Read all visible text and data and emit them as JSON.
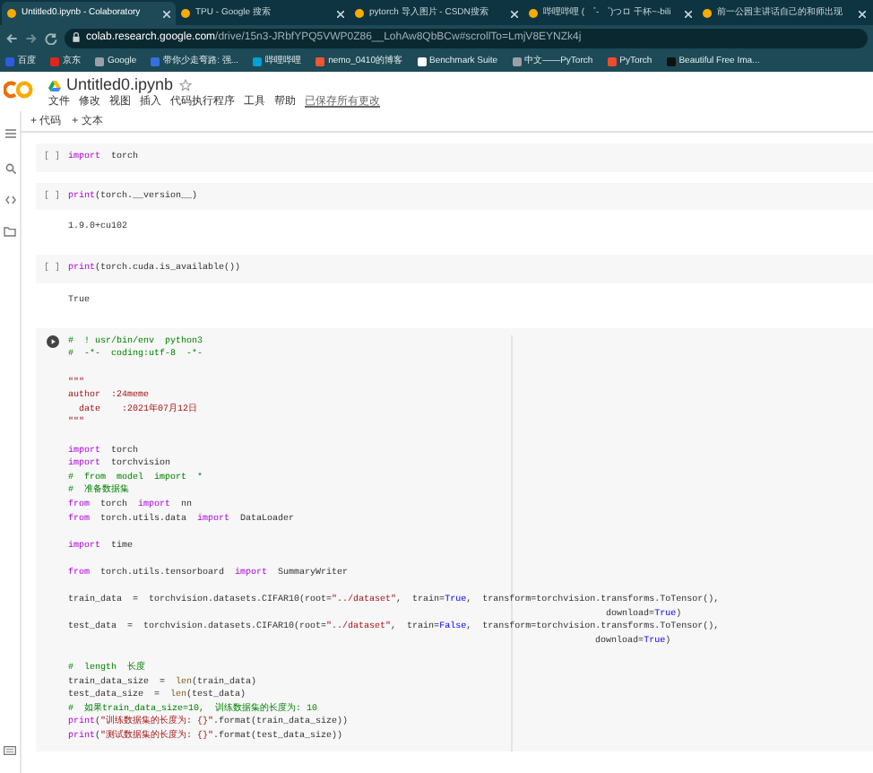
{
  "tabs": [
    {
      "title": "Untitled0.ipynb - Colaboratory",
      "selected": true
    },
    {
      "title": "TPU - Google 搜索",
      "selected": false
    },
    {
      "title": "pytorch 导入图片 - CSDN搜索",
      "selected": false
    },
    {
      "title": "哔哩哔哩 ( ゜- ゜)つロ 干杯~-bili",
      "selected": false
    },
    {
      "title": "前一公园主讲话自己的和师出现",
      "selected": false
    }
  ],
  "address": {
    "host": "colab.research.google.com",
    "path": "/drive/15n3-JRbfYPQ5VWP0Z86__LohAw8QbBCw#scrollTo=LmjV8EYNZk4j"
  },
  "bookmarks": [
    {
      "label": "百度",
      "color": "#2d5be3"
    },
    {
      "label": "京东",
      "color": "#e1251b"
    },
    {
      "label": "Google",
      "color": "#9aa0a6"
    },
    {
      "label": "带你少走弯路: 强...",
      "color": "#3670e0"
    },
    {
      "label": "哔哩哔哩",
      "color": "#00a1d6"
    },
    {
      "label": "nemo_0410的博客",
      "color": "#fc5531"
    },
    {
      "label": "Benchmark Suite",
      "color": "#ffffff"
    },
    {
      "label": "中文——PyTorch",
      "color": "#9aa0a6"
    },
    {
      "label": "PyTorch",
      "color": "#ee4c2c"
    },
    {
      "label": "Beautiful Free Ima...",
      "color": "#111111"
    }
  ],
  "notebook": {
    "title": "Untitled0.ipynb",
    "menu": [
      "文件",
      "修改",
      "视图",
      "插入",
      "代码执行程序",
      "工具",
      "帮助"
    ],
    "save_status": "已保存所有更改",
    "toolbar": [
      "+ 代码",
      "+ 文本"
    ]
  },
  "cells": [
    {
      "run_label": "[ ]",
      "lines": [
        {
          "segments": [
            {
              "kind": "keyword",
              "t": "import"
            },
            {
              "kind": "plain",
              "t": "  torch"
            }
          ]
        }
      ]
    },
    {
      "run_label": "[ ]",
      "lines": [
        {
          "segments": [
            {
              "kind": "keyword",
              "t": "print"
            },
            {
              "kind": "plain",
              "t": "(torch.__version__)"
            }
          ]
        }
      ],
      "output": "1.9.0+cu102"
    },
    {
      "run_label": "[ ]",
      "lines": [
        {
          "segments": [
            {
              "kind": "keyword",
              "t": "print"
            },
            {
              "kind": "plain",
              "t": "(torch.cuda.is_available())"
            }
          ]
        }
      ],
      "output": "True"
    },
    {
      "lines": [
        {
          "segments": [
            {
              "kind": "comment",
              "t": "#  ! usr/bin/env  python3"
            }
          ]
        },
        {
          "segments": [
            {
              "kind": "comment",
              "t": "#  -*-  coding:utf-8  -*-"
            }
          ]
        },
        {
          "space_before": true,
          "segments": [
            {
              "kind": "string",
              "t": "\"\"\""
            }
          ]
        },
        {
          "segments": [
            {
              "kind": "string",
              "t": "author  :24meme"
            }
          ]
        },
        {
          "segments": [
            {
              "kind": "string",
              "t": "  date    :2021年07月12日"
            }
          ]
        },
        {
          "segments": [
            {
              "kind": "string",
              "t": "\"\"\""
            }
          ]
        },
        {
          "space_before": true,
          "segments": [
            {
              "kind": "keyword",
              "t": "import"
            },
            {
              "kind": "plain",
              "t": "  torch"
            }
          ]
        },
        {
          "segments": [
            {
              "kind": "keyword",
              "t": "import"
            },
            {
              "kind": "plain",
              "t": "  torchvision"
            }
          ]
        },
        {
          "segments": [
            {
              "kind": "comment",
              "t": "#  from  model  import  *"
            }
          ]
        },
        {
          "segments": [
            {
              "kind": "comment",
              "t": "#  准备数据集"
            }
          ]
        },
        {
          "segments": [
            {
              "kind": "keyword",
              "t": "from"
            },
            {
              "kind": "plain",
              "t": "  torch  "
            },
            {
              "kind": "keyword",
              "t": "import"
            },
            {
              "kind": "plain",
              "t": "  nn"
            }
          ]
        },
        {
          "segments": [
            {
              "kind": "keyword",
              "t": "from"
            },
            {
              "kind": "plain",
              "t": "  torch.utils.data  "
            },
            {
              "kind": "keyword",
              "t": "import"
            },
            {
              "kind": "plain",
              "t": "  DataLoader"
            }
          ]
        },
        {
          "space_before": true,
          "segments": [
            {
              "kind": "keyword",
              "t": "import"
            },
            {
              "kind": "plain",
              "t": "  time"
            }
          ]
        },
        {
          "space_before": true,
          "segments": [
            {
              "kind": "keyword",
              "t": "from"
            },
            {
              "kind": "plain",
              "t": "  torch.utils.tensorboard  "
            },
            {
              "kind": "keyword",
              "t": "import"
            },
            {
              "kind": "plain",
              "t": "  SummaryWriter"
            }
          ]
        },
        {
          "space_before": true,
          "segments": [
            {
              "kind": "plain",
              "t": "train_data  =  torchvision.datasets.CIFAR10(root="
            },
            {
              "kind": "string",
              "t": "\"../dataset\""
            },
            {
              "kind": "plain",
              "t": ",  train="
            },
            {
              "kind": "constant",
              "t": "True"
            },
            {
              "kind": "plain",
              "t": ",  transform=torchvision.transforms.ToTensor(),"
            }
          ]
        },
        {
          "segments": [
            {
              "kind": "plain",
              "t": "                                                                                                    download="
            },
            {
              "kind": "constant",
              "t": "True"
            },
            {
              "kind": "plain",
              "t": ")"
            }
          ]
        },
        {
          "segments": [
            {
              "kind": "plain",
              "t": "test_data  =  torchvision.datasets.CIFAR10(root="
            },
            {
              "kind": "string",
              "t": "\"../dataset\""
            },
            {
              "kind": "plain",
              "t": ",  train="
            },
            {
              "kind": "constant",
              "t": "False"
            },
            {
              "kind": "plain",
              "t": ",  transform=torchvision.transforms.ToTensor(),"
            }
          ]
        },
        {
          "segments": [
            {
              "kind": "plain",
              "t": "                                                                                                  download="
            },
            {
              "kind": "constant",
              "t": "True"
            },
            {
              "kind": "plain",
              "t": ")"
            }
          ]
        },
        {
          "space_before": true,
          "segments": [
            {
              "kind": "comment",
              "t": "#  length  长度"
            }
          ]
        },
        {
          "segments": [
            {
              "kind": "plain",
              "t": "train_data_size  =  "
            },
            {
              "kind": "function",
              "t": "len"
            },
            {
              "kind": "plain",
              "t": "(train_data)"
            }
          ]
        },
        {
          "segments": [
            {
              "kind": "plain",
              "t": "test_data_size  =  "
            },
            {
              "kind": "function",
              "t": "len"
            },
            {
              "kind": "plain",
              "t": "(test_data)"
            }
          ]
        },
        {
          "segments": [
            {
              "kind": "comment",
              "t": "#  如果train_data_size=10,  训练数据集的长度为: 10"
            }
          ]
        },
        {
          "segments": [
            {
              "kind": "keyword",
              "t": "print"
            },
            {
              "kind": "plain",
              "t": "("
            },
            {
              "kind": "string",
              "t": "\"训练数据集的长度为: {}\""
            },
            {
              "kind": "plain",
              "t": ".format(train_data_size))"
            }
          ]
        },
        {
          "segments": [
            {
              "kind": "keyword",
              "t": "print"
            },
            {
              "kind": "plain",
              "t": "("
            },
            {
              "kind": "string",
              "t": "\"测试数据集的长度为: {}\""
            },
            {
              "kind": "plain",
              "t": ".format(test_data_size))"
            }
          ]
        }
      ]
    }
  ]
}
